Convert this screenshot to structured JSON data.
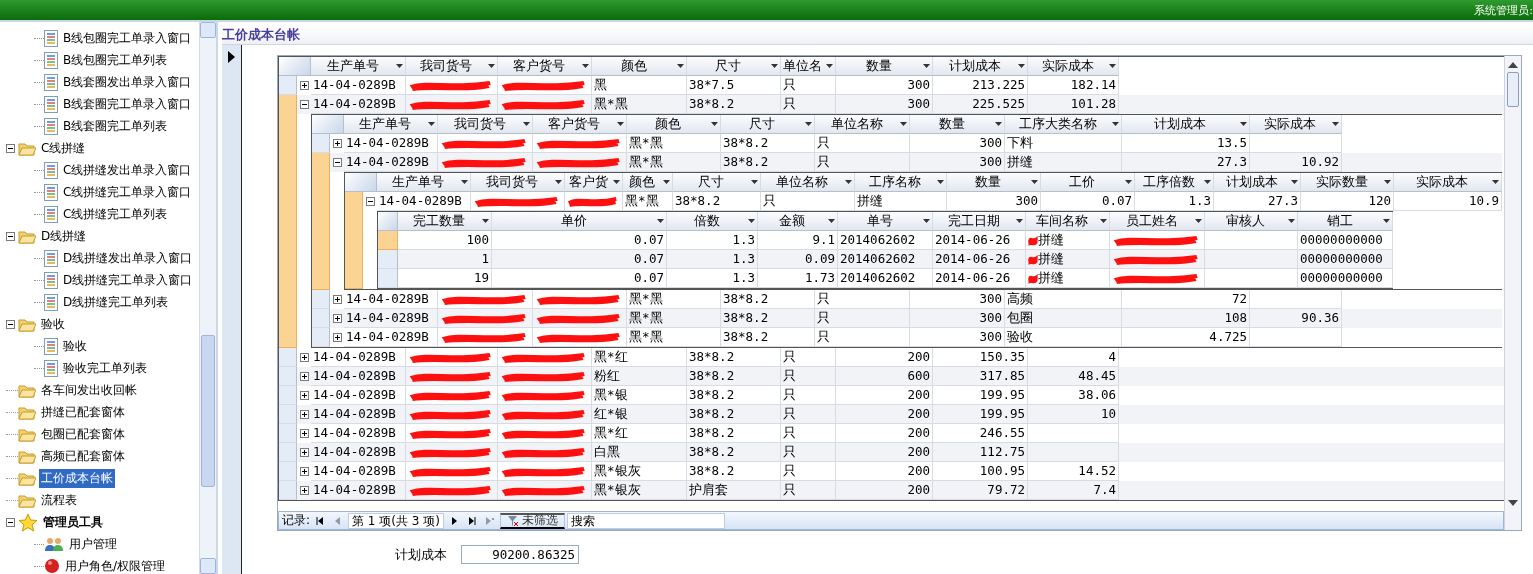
{
  "title_bar": {
    "user_label": "系统管理员:"
  },
  "sidebar": {
    "continued_children": [
      {
        "kind": "doc",
        "label": "B线包圈完工单录入窗口",
        "selected": false
      },
      {
        "kind": "doc",
        "label": "B线包圈完工单列表",
        "selected": false
      },
      {
        "kind": "doc",
        "label": "B线套圈发出单录入窗口",
        "selected": false
      },
      {
        "kind": "doc",
        "label": "B线套圈完工单录入窗口",
        "selected": false
      },
      {
        "kind": "doc",
        "label": "B线套圈完工单列表",
        "selected": false
      }
    ],
    "items": [
      {
        "kind": "folder",
        "label": "C线拼缝",
        "selected": false,
        "expanded": true,
        "children": [
          {
            "kind": "doc",
            "label": "C线拼缝发出单录入窗口",
            "selected": false
          },
          {
            "kind": "doc",
            "label": "C线拼缝完工单录入窗口",
            "selected": false
          },
          {
            "kind": "doc",
            "label": "C线拼缝完工单列表",
            "selected": false
          }
        ]
      },
      {
        "kind": "folder",
        "label": "D线拼缝",
        "selected": false,
        "expanded": true,
        "children": [
          {
            "kind": "doc",
            "label": "D线拼缝发出单录入窗口",
            "selected": false
          },
          {
            "kind": "doc",
            "label": "D线拼缝完工单录入窗口",
            "selected": false
          },
          {
            "kind": "doc",
            "label": "D线拼缝完工单列表",
            "selected": false
          }
        ]
      },
      {
        "kind": "folder",
        "label": "验收",
        "selected": false,
        "expanded": true,
        "children": [
          {
            "kind": "doc",
            "label": "验收",
            "selected": false
          },
          {
            "kind": "doc",
            "label": "验收完工单列表",
            "selected": false
          }
        ]
      },
      {
        "kind": "folder",
        "label": "各车间发出收回帐",
        "selected": false
      },
      {
        "kind": "folder",
        "label": "拼缝已配套窗体",
        "selected": false
      },
      {
        "kind": "folder",
        "label": "包圈已配套窗体",
        "selected": false
      },
      {
        "kind": "folder",
        "label": "高频已配套窗体",
        "selected": false
      },
      {
        "kind": "folder",
        "label": "工价成本台帐",
        "selected": true
      },
      {
        "kind": "folder",
        "label": "流程表",
        "selected": false
      },
      {
        "kind": "star",
        "label": "管理员工具",
        "selected": false,
        "expanded": true,
        "children": [
          {
            "kind": "users",
            "label": "用户管理",
            "selected": false
          },
          {
            "kind": "ball",
            "label": "用户角色/权限管理",
            "selected": false
          }
        ]
      }
    ]
  },
  "panel_title": "工价成本台帐",
  "grid": {
    "columns": [
      "生产单号",
      "我司货号",
      "客户货号",
      "颜色",
      "尺寸",
      "单位名",
      "数量",
      "计划成本",
      "实际成本"
    ],
    "rows": [
      {
        "selected": false,
        "expanded": false,
        "cells": [
          "14-04-0289B",
          {
            "redacted": true
          },
          {
            "redacted": true
          },
          "黑",
          "38*7.5",
          "只",
          "300",
          "213.225",
          "182.14"
        ]
      },
      {
        "selected": true,
        "expanded": true,
        "cells": [
          "14-04-0289B",
          {
            "redacted": true
          },
          {
            "redacted": true
          },
          "黑*黑",
          "38*8.2",
          "只",
          "300",
          "225.525",
          "101.28"
        ],
        "child": {
          "columns": [
            "生产单号",
            "我司货号",
            "客户货号",
            "颜色",
            "尺寸",
            "单位名称",
            "数量",
            "工序大类名称",
            "计划成本",
            "实际成本"
          ],
          "rows": [
            {
              "selected": false,
              "expanded": false,
              "cells": [
                "14-04-0289B",
                {
                  "redacted": true
                },
                {
                  "redacted": true
                },
                "黑*黑",
                "38*8.2",
                "只",
                "300",
                "下料",
                "13.5",
                ""
              ]
            },
            {
              "selected": true,
              "expanded": true,
              "cells": [
                "14-04-0289B",
                {
                  "redacted": true
                },
                {
                  "redacted": true
                },
                "黑*黑",
                "38*8.2",
                "只",
                "300",
                "拼缝",
                "27.3",
                "10.92"
              ],
              "child": {
                "columns": [
                  "生产单号",
                  "我司货号",
                  "客户货",
                  "颜色",
                  "尺寸",
                  "单位名称",
                  "工序名称",
                  "数量",
                  "工价",
                  "工序倍数",
                  "计划成本",
                  "实际数量",
                  "实际成本"
                ],
                "rows": [
                  {
                    "selected": true,
                    "expanded": true,
                    "cells": [
                      "14-04-0289B",
                      {
                        "redacted": true
                      },
                      {
                        "redacted": true
                      },
                      "黑*黑",
                      "38*8.2",
                      "只",
                      "拼缝",
                      "300",
                      "0.07",
                      "1.3",
                      "27.3",
                      "120",
                      "10.9"
                    ],
                    "child": {
                      "columns": [
                        "完工数量",
                        "单价",
                        "倍数",
                        "金额",
                        "单号",
                        "完工日期",
                        "车间名称",
                        "员工姓名",
                        "审核人",
                        "销工"
                      ],
                      "rows": [
                        {
                          "selected": true,
                          "cells": [
                            "100",
                            "0.07",
                            "1.3",
                            "9.1",
                            "2014062602",
                            "2014-06-26",
                            {
                              "text": "拼缝",
                              "redacted": true
                            },
                            {
                              "redacted": true
                            },
                            "",
                            "00000000000"
                          ]
                        },
                        {
                          "selected": false,
                          "cells": [
                            "1",
                            "0.07",
                            "1.3",
                            "0.09",
                            "2014062602",
                            "2014-06-26",
                            {
                              "text": "拼缝",
                              "redacted": true
                            },
                            {
                              "redacted": true
                            },
                            "",
                            "00000000000"
                          ]
                        },
                        {
                          "selected": false,
                          "cells": [
                            "19",
                            "0.07",
                            "1.3",
                            "1.73",
                            "2014062602",
                            "2014-06-26",
                            {
                              "text": "拼缝",
                              "redacted": true
                            },
                            {
                              "redacted": true
                            },
                            "",
                            "00000000000"
                          ]
                        }
                      ]
                    }
                  }
                ]
              }
            },
            {
              "selected": false,
              "expanded": false,
              "cells": [
                "14-04-0289B",
                {
                  "redacted": true
                },
                {
                  "redacted": true
                },
                "黑*黑",
                "38*8.2",
                "只",
                "300",
                "高频",
                "72",
                ""
              ]
            },
            {
              "selected": false,
              "expanded": false,
              "cells": [
                "14-04-0289B",
                {
                  "redacted": true
                },
                {
                  "redacted": true
                },
                "黑*黑",
                "38*8.2",
                "只",
                "300",
                "包圈",
                "108",
                "90.36"
              ]
            },
            {
              "selected": false,
              "expanded": false,
              "cells": [
                "14-04-0289B",
                {
                  "redacted": true
                },
                {
                  "redacted": true
                },
                "黑*黑",
                "38*8.2",
                "只",
                "300",
                "验收",
                "4.725",
                ""
              ]
            }
          ]
        }
      },
      {
        "selected": false,
        "expanded": false,
        "cells": [
          "14-04-0289B",
          {
            "redacted": true
          },
          {
            "redacted": true
          },
          "黑*红",
          "38*8.2",
          "只",
          "200",
          "150.35",
          "4"
        ]
      },
      {
        "selected": false,
        "expanded": false,
        "cells": [
          "14-04-0289B",
          {
            "redacted": true
          },
          {
            "redacted": true
          },
          "粉红",
          "38*8.2",
          "只",
          "600",
          "317.85",
          "48.45"
        ]
      },
      {
        "selected": false,
        "expanded": false,
        "cells": [
          "14-04-0289B",
          {
            "redacted": true
          },
          {
            "redacted": true
          },
          "黑*银",
          "38*8.2",
          "只",
          "200",
          "199.95",
          "38.06"
        ]
      },
      {
        "selected": false,
        "expanded": false,
        "cells": [
          "14-04-0289B",
          {
            "redacted": true
          },
          {
            "redacted": true
          },
          "红*银",
          "38*8.2",
          "只",
          "200",
          "199.95",
          "10"
        ]
      },
      {
        "selected": false,
        "expanded": false,
        "cells": [
          "14-04-0289B",
          {
            "redacted": true
          },
          {
            "redacted": true
          },
          "黑*红",
          "38*8.2",
          "只",
          "200",
          "246.55",
          ""
        ]
      },
      {
        "selected": false,
        "expanded": false,
        "cells": [
          "14-04-0289B",
          {
            "redacted": true
          },
          {
            "redacted": true
          },
          "白黑",
          "38*8.2",
          "只",
          "200",
          "112.75",
          ""
        ]
      },
      {
        "selected": false,
        "expanded": false,
        "cells": [
          "14-04-0289B",
          {
            "redacted": true
          },
          {
            "redacted": true
          },
          "黑*银灰",
          "38*8.2",
          "只",
          "200",
          "100.95",
          "14.52"
        ]
      },
      {
        "selected": false,
        "expanded": false,
        "cells": [
          "14-04-0289B",
          {
            "redacted": true
          },
          {
            "redacted": true
          },
          "黑*银灰",
          "护肩套",
          "只",
          "200",
          "79.72",
          "7.4"
        ]
      }
    ]
  },
  "record_nav": {
    "label": "记录:",
    "position": "第 1 项(共 3 项)",
    "filter": "未筛选",
    "search_placeholder": "搜索"
  },
  "summary": {
    "label": "计划成本",
    "value": "90200.86325"
  }
}
